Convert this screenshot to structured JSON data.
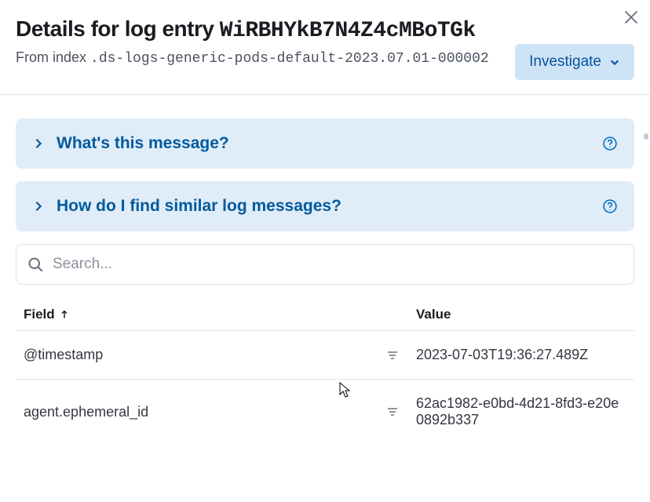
{
  "header": {
    "title_prefix": "Details for log entry ",
    "entry_id": "WiRBHYkB7N4Z4cMBoTGk",
    "subtitle_prefix": "From index ",
    "index": ".ds-logs-generic-pods-default-2023.07.01-000002",
    "investigate_label": "Investigate"
  },
  "callouts": [
    {
      "title": "What's this message?"
    },
    {
      "title": "How do I find similar log messages?"
    }
  ],
  "search": {
    "placeholder": "Search..."
  },
  "table": {
    "headers": {
      "field": "Field",
      "value": "Value"
    },
    "rows": [
      {
        "field": "@timestamp",
        "value": "2023-07-03T19:36:27.489Z"
      },
      {
        "field": "agent.ephemeral_id",
        "value": "62ac1982-e0bd-4d21-8fd3-e20e0892b337"
      }
    ]
  }
}
